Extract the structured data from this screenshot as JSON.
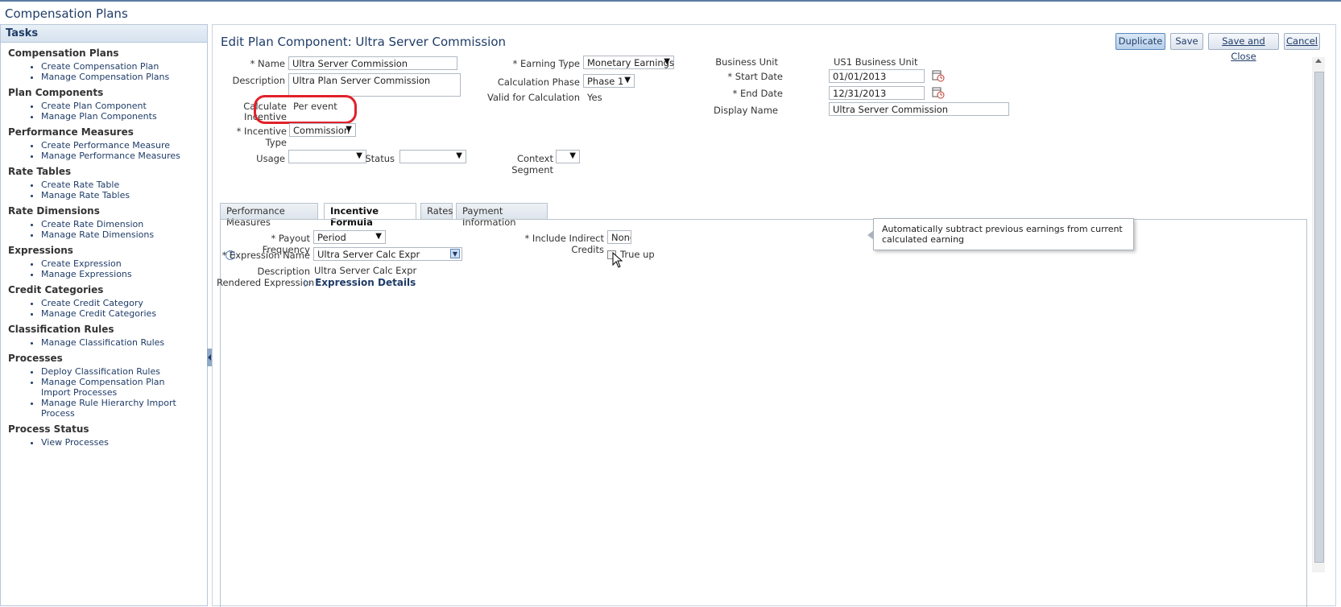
{
  "app": {
    "title": "Compensation Plans"
  },
  "tasks": {
    "header": "Tasks",
    "groups": [
      {
        "title": "Compensation Plans",
        "items": [
          "Create Compensation Plan",
          "Manage Compensation Plans"
        ]
      },
      {
        "title": "Plan Components",
        "items": [
          "Create Plan Component",
          "Manage Plan Components"
        ]
      },
      {
        "title": "Performance Measures",
        "items": [
          "Create Performance Measure",
          "Manage Performance Measures"
        ]
      },
      {
        "title": "Rate Tables",
        "items": [
          "Create Rate Table",
          "Manage Rate Tables"
        ]
      },
      {
        "title": "Rate Dimensions",
        "items": [
          "Create Rate Dimension",
          "Manage Rate Dimensions"
        ]
      },
      {
        "title": "Expressions",
        "items": [
          "Create Expression",
          "Manage Expressions"
        ]
      },
      {
        "title": "Credit Categories",
        "items": [
          "Create Credit Category",
          "Manage Credit Categories"
        ]
      },
      {
        "title": "Classification Rules",
        "items": [
          "Manage Classification Rules"
        ]
      },
      {
        "title": "Processes",
        "items": [
          "Deploy Classification Rules",
          "Manage Compensation Plan Import Processes",
          "Manage Rule Hierarchy Import Process"
        ]
      },
      {
        "title": "Process Status",
        "items": [
          "View Processes"
        ]
      }
    ]
  },
  "page": {
    "title": "Edit Plan Component: Ultra Server Commission",
    "buttons": {
      "duplicate": "Duplicate",
      "save": "Save",
      "save_close": "Save and Close",
      "cancel": "Cancel"
    }
  },
  "form": {
    "name_label": "* Name",
    "name_value": "Ultra Server Commission",
    "description_label": "Description",
    "description_value": "Ultra Plan Server Commission",
    "calculate_label_1": "Calculate",
    "calculate_label_2": "Incentive",
    "calculate_value": "Per event",
    "incentive_type_label": "* Incentive Type",
    "incentive_type_value": "Commission",
    "earning_type_label": "* Earning Type",
    "earning_type_value": "Monetary Earnings",
    "calc_phase_label": "Calculation Phase",
    "calc_phase_value": "Phase 1",
    "valid_label": "Valid for Calculation",
    "valid_value": "Yes",
    "bu_label": "Business Unit",
    "bu_value": "US1 Business Unit",
    "start_label": "* Start Date",
    "start_value": "01/01/2013",
    "end_label": "* End Date",
    "end_value": "12/31/2013",
    "display_label": "Display Name",
    "display_value": "Ultra Server Commission",
    "usage_label": "Usage",
    "status_label": "Status",
    "context_label": "Context Segment"
  },
  "tabs": [
    "Performance Measures",
    "Incentive Formula",
    "Rates",
    "Payment Information"
  ],
  "formula": {
    "payout_label": "* Payout Frequency",
    "payout_value": "Period",
    "expr_name_label": "* Expression Name",
    "expr_name_value": "Ultra Server Calc Expr",
    "desc_label": "Description",
    "desc_value": "Ultra Server Calc Expr",
    "rendered_label": "Rendered Expression",
    "details_link": "Expression Details",
    "indirect_label": "* Include Indirect Credits",
    "indirect_value": "None",
    "trueup_label": "True up"
  },
  "tooltip": {
    "text": "Automatically subtract previous earnings from current calculated earning"
  },
  "colors": {
    "title": "#1f3c68",
    "highlight": "#e0222a",
    "link": "#1f3c68"
  }
}
